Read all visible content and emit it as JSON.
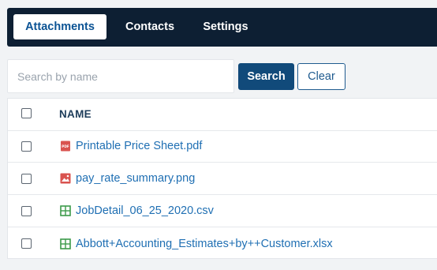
{
  "tabs": [
    {
      "label": "Attachments",
      "active": true
    },
    {
      "label": "Contacts",
      "active": false
    },
    {
      "label": "Settings",
      "active": false
    }
  ],
  "search": {
    "placeholder": "Search by name",
    "value": "",
    "search_label": "Search",
    "clear_label": "Clear"
  },
  "table": {
    "column_name": "NAME",
    "rows": [
      {
        "name": "Printable Price Sheet.pdf",
        "icon": "pdf-icon",
        "icon_color": "#d9534f"
      },
      {
        "name": "pay_rate_summary.png",
        "icon": "image-icon",
        "icon_color": "#d9534f"
      },
      {
        "name": "JobDetail_06_25_2020.csv",
        "icon": "spreadsheet-icon",
        "icon_color": "#3c9a4a"
      },
      {
        "name": "Abbott+Accounting_Estimates+by++Customer.xlsx",
        "icon": "spreadsheet-icon",
        "icon_color": "#3c9a4a"
      }
    ]
  },
  "colors": {
    "topbar": "#0d1f33",
    "primary": "#114a7a",
    "link": "#1f6fb3"
  }
}
